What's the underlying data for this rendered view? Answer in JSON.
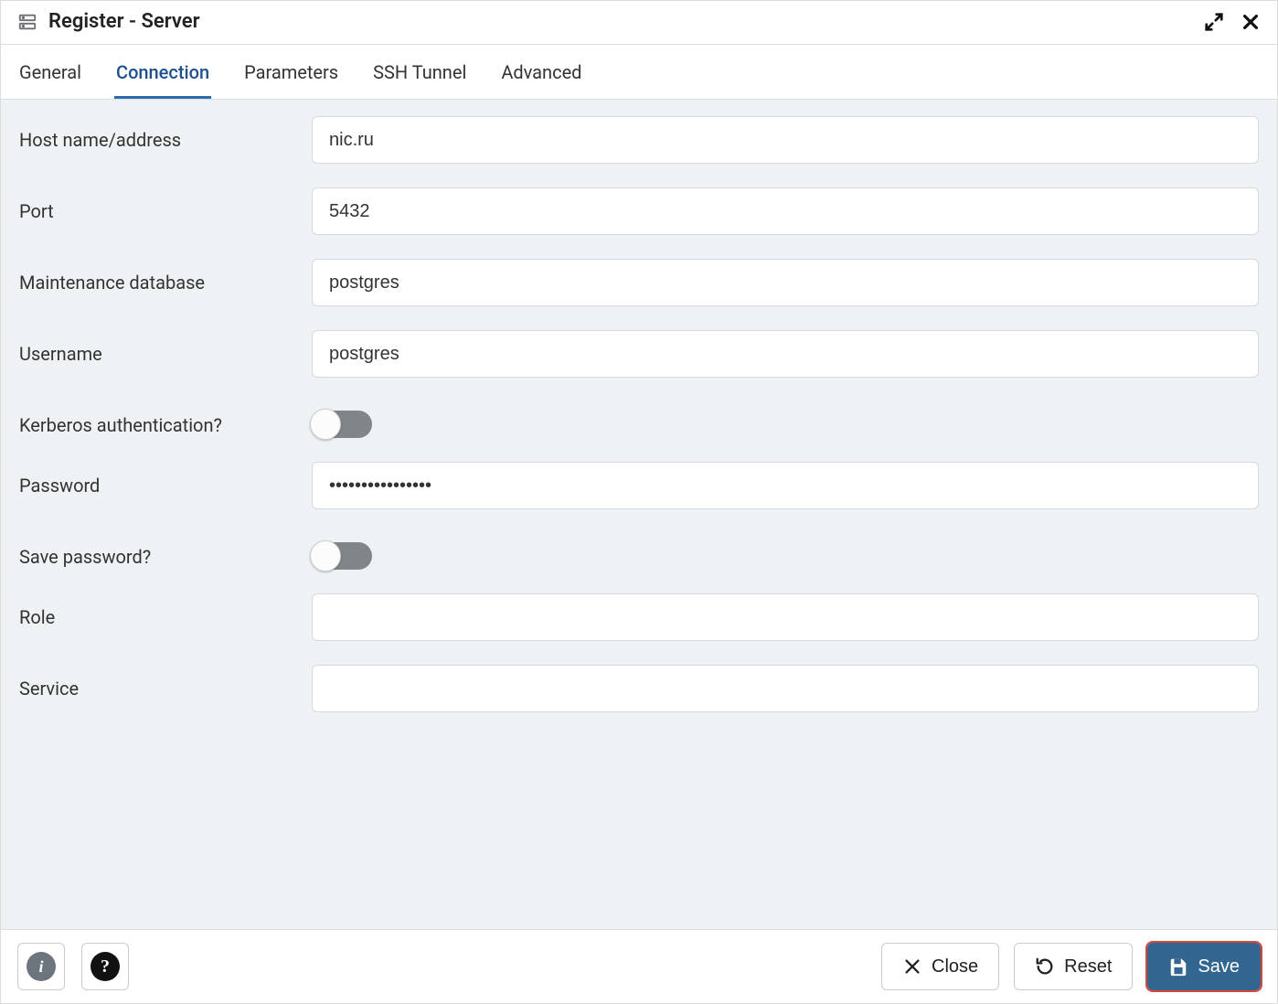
{
  "header": {
    "title": "Register - Server"
  },
  "tabs": [
    {
      "label": "General",
      "active": false
    },
    {
      "label": "Connection",
      "active": true
    },
    {
      "label": "Parameters",
      "active": false
    },
    {
      "label": "SSH Tunnel",
      "active": false
    },
    {
      "label": "Advanced",
      "active": false
    }
  ],
  "form": {
    "host_label": "Host name/address",
    "host_value": "nic.ru",
    "port_label": "Port",
    "port_value": "5432",
    "maintenance_label": "Maintenance database",
    "maintenance_value": "postgres",
    "username_label": "Username",
    "username_value": "postgres",
    "kerberos_label": "Kerberos authentication?",
    "kerberos_on": false,
    "password_label": "Password",
    "password_value": "••••••••••••••••",
    "savepw_label": "Save password?",
    "savepw_on": false,
    "role_label": "Role",
    "role_value": "",
    "service_label": "Service",
    "service_value": ""
  },
  "footer": {
    "close_label": "Close",
    "reset_label": "Reset",
    "save_label": "Save"
  }
}
